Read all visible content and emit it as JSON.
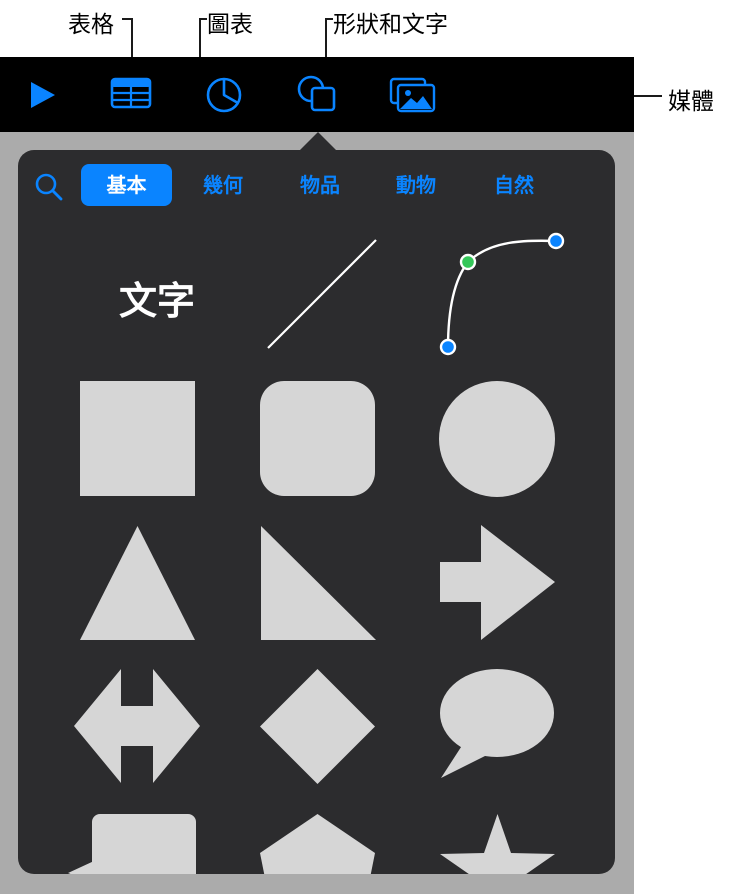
{
  "callouts": {
    "table": "表格",
    "chart": "圖表",
    "shape_text": "形狀和文字",
    "media": "媒體"
  },
  "toolbar": {
    "buttons": [
      "play-icon",
      "table-icon",
      "chart-icon",
      "shape-icon",
      "media-icon"
    ],
    "accent": "#0a84ff"
  },
  "shapes_panel": {
    "search_icon": "search-icon",
    "tabs": [
      {
        "label": "基本",
        "selected": true
      },
      {
        "label": "幾何",
        "selected": false
      },
      {
        "label": "物品",
        "selected": false
      },
      {
        "label": "動物",
        "selected": false
      },
      {
        "label": "自然",
        "selected": false
      }
    ],
    "text_shape_label": "文字",
    "shapes": [
      "text",
      "line",
      "curve",
      "square",
      "rounded-square",
      "circle",
      "triangle",
      "right-triangle",
      "arrow",
      "double-arrow",
      "diamond",
      "speech-bubble",
      "callout-square",
      "pentagon",
      "star"
    ]
  },
  "colors": {
    "toolbar_bg": "#000000",
    "panel_bg": "#2c2c2e",
    "shape_fill": "#d6d6d6",
    "accent": "#0a84ff"
  }
}
